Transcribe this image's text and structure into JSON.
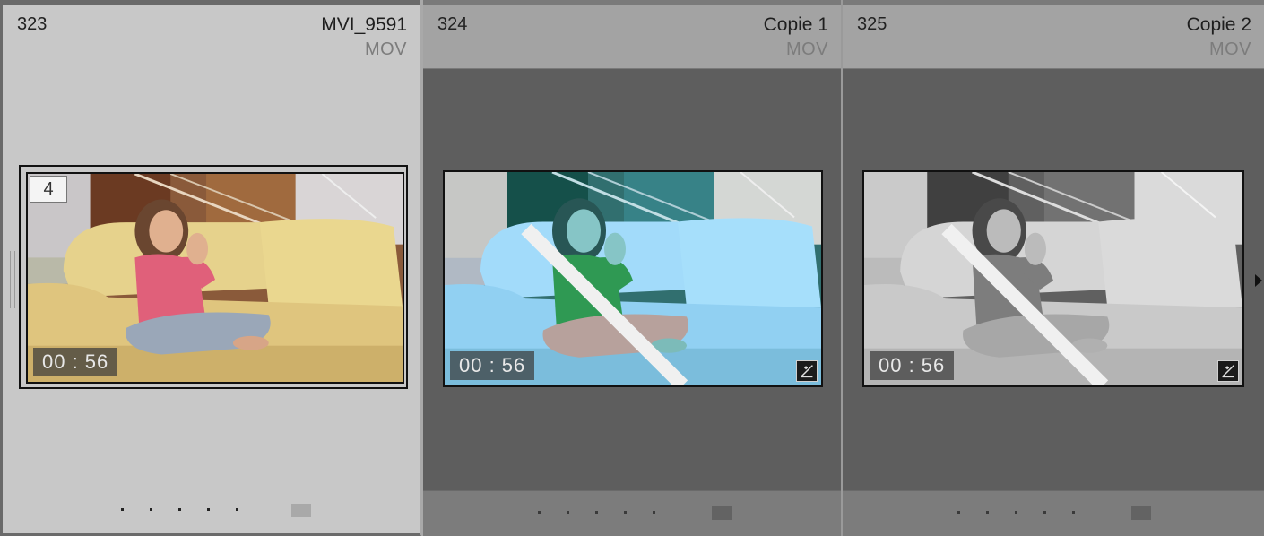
{
  "cells": [
    {
      "index": "323",
      "name": "MVI_9591",
      "type": "MOV",
      "duration": "00 : 56",
      "badge": "4",
      "selected": true
    },
    {
      "index": "324",
      "name": "Copie 1",
      "type": "MOV",
      "duration": "00 : 56",
      "selected": false
    },
    {
      "index": "325",
      "name": "Copie 2",
      "type": "MOV",
      "duration": "00 : 56",
      "selected": false
    }
  ],
  "colors": {
    "selected_cell_bg": "#c8c8c8",
    "cell_bg": "#5e5e5e",
    "header_bg": "#a3a3a3",
    "footer_bg": "#7c7c7c"
  },
  "icons": [
    "edit-adjustment-icon",
    "video-corner-icon",
    "arrow-right-icon",
    "flag-icon",
    "rating-dots"
  ]
}
